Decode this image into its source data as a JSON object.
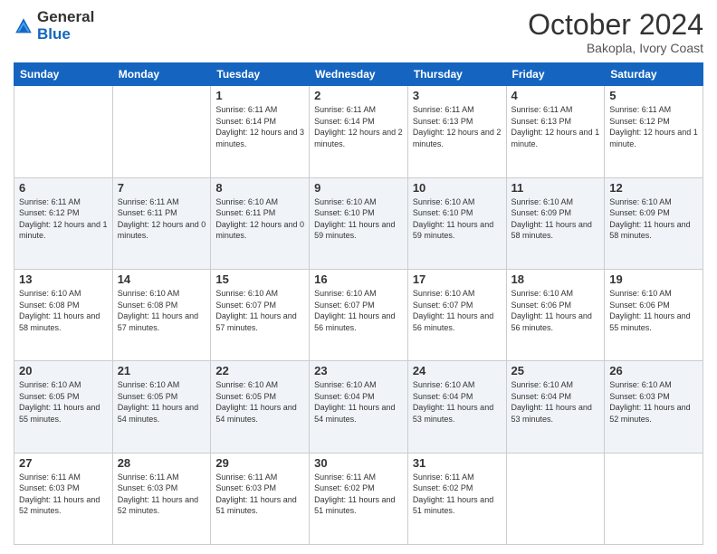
{
  "header": {
    "logo_general": "General",
    "logo_blue": "Blue",
    "month": "October 2024",
    "location": "Bakopla, Ivory Coast"
  },
  "weekdays": [
    "Sunday",
    "Monday",
    "Tuesday",
    "Wednesday",
    "Thursday",
    "Friday",
    "Saturday"
  ],
  "weeks": [
    [
      {
        "day": "",
        "text": ""
      },
      {
        "day": "",
        "text": ""
      },
      {
        "day": "1",
        "text": "Sunrise: 6:11 AM\nSunset: 6:14 PM\nDaylight: 12 hours and 3 minutes."
      },
      {
        "day": "2",
        "text": "Sunrise: 6:11 AM\nSunset: 6:14 PM\nDaylight: 12 hours and 2 minutes."
      },
      {
        "day": "3",
        "text": "Sunrise: 6:11 AM\nSunset: 6:13 PM\nDaylight: 12 hours and 2 minutes."
      },
      {
        "day": "4",
        "text": "Sunrise: 6:11 AM\nSunset: 6:13 PM\nDaylight: 12 hours and 1 minute."
      },
      {
        "day": "5",
        "text": "Sunrise: 6:11 AM\nSunset: 6:12 PM\nDaylight: 12 hours and 1 minute."
      }
    ],
    [
      {
        "day": "6",
        "text": "Sunrise: 6:11 AM\nSunset: 6:12 PM\nDaylight: 12 hours and 1 minute."
      },
      {
        "day": "7",
        "text": "Sunrise: 6:11 AM\nSunset: 6:11 PM\nDaylight: 12 hours and 0 minutes."
      },
      {
        "day": "8",
        "text": "Sunrise: 6:10 AM\nSunset: 6:11 PM\nDaylight: 12 hours and 0 minutes."
      },
      {
        "day": "9",
        "text": "Sunrise: 6:10 AM\nSunset: 6:10 PM\nDaylight: 11 hours and 59 minutes."
      },
      {
        "day": "10",
        "text": "Sunrise: 6:10 AM\nSunset: 6:10 PM\nDaylight: 11 hours and 59 minutes."
      },
      {
        "day": "11",
        "text": "Sunrise: 6:10 AM\nSunset: 6:09 PM\nDaylight: 11 hours and 58 minutes."
      },
      {
        "day": "12",
        "text": "Sunrise: 6:10 AM\nSunset: 6:09 PM\nDaylight: 11 hours and 58 minutes."
      }
    ],
    [
      {
        "day": "13",
        "text": "Sunrise: 6:10 AM\nSunset: 6:08 PM\nDaylight: 11 hours and 58 minutes."
      },
      {
        "day": "14",
        "text": "Sunrise: 6:10 AM\nSunset: 6:08 PM\nDaylight: 11 hours and 57 minutes."
      },
      {
        "day": "15",
        "text": "Sunrise: 6:10 AM\nSunset: 6:07 PM\nDaylight: 11 hours and 57 minutes."
      },
      {
        "day": "16",
        "text": "Sunrise: 6:10 AM\nSunset: 6:07 PM\nDaylight: 11 hours and 56 minutes."
      },
      {
        "day": "17",
        "text": "Sunrise: 6:10 AM\nSunset: 6:07 PM\nDaylight: 11 hours and 56 minutes."
      },
      {
        "day": "18",
        "text": "Sunrise: 6:10 AM\nSunset: 6:06 PM\nDaylight: 11 hours and 56 minutes."
      },
      {
        "day": "19",
        "text": "Sunrise: 6:10 AM\nSunset: 6:06 PM\nDaylight: 11 hours and 55 minutes."
      }
    ],
    [
      {
        "day": "20",
        "text": "Sunrise: 6:10 AM\nSunset: 6:05 PM\nDaylight: 11 hours and 55 minutes."
      },
      {
        "day": "21",
        "text": "Sunrise: 6:10 AM\nSunset: 6:05 PM\nDaylight: 11 hours and 54 minutes."
      },
      {
        "day": "22",
        "text": "Sunrise: 6:10 AM\nSunset: 6:05 PM\nDaylight: 11 hours and 54 minutes."
      },
      {
        "day": "23",
        "text": "Sunrise: 6:10 AM\nSunset: 6:04 PM\nDaylight: 11 hours and 54 minutes."
      },
      {
        "day": "24",
        "text": "Sunrise: 6:10 AM\nSunset: 6:04 PM\nDaylight: 11 hours and 53 minutes."
      },
      {
        "day": "25",
        "text": "Sunrise: 6:10 AM\nSunset: 6:04 PM\nDaylight: 11 hours and 53 minutes."
      },
      {
        "day": "26",
        "text": "Sunrise: 6:10 AM\nSunset: 6:03 PM\nDaylight: 11 hours and 52 minutes."
      }
    ],
    [
      {
        "day": "27",
        "text": "Sunrise: 6:11 AM\nSunset: 6:03 PM\nDaylight: 11 hours and 52 minutes."
      },
      {
        "day": "28",
        "text": "Sunrise: 6:11 AM\nSunset: 6:03 PM\nDaylight: 11 hours and 52 minutes."
      },
      {
        "day": "29",
        "text": "Sunrise: 6:11 AM\nSunset: 6:03 PM\nDaylight: 11 hours and 51 minutes."
      },
      {
        "day": "30",
        "text": "Sunrise: 6:11 AM\nSunset: 6:02 PM\nDaylight: 11 hours and 51 minutes."
      },
      {
        "day": "31",
        "text": "Sunrise: 6:11 AM\nSunset: 6:02 PM\nDaylight: 11 hours and 51 minutes."
      },
      {
        "day": "",
        "text": ""
      },
      {
        "day": "",
        "text": ""
      }
    ]
  ]
}
